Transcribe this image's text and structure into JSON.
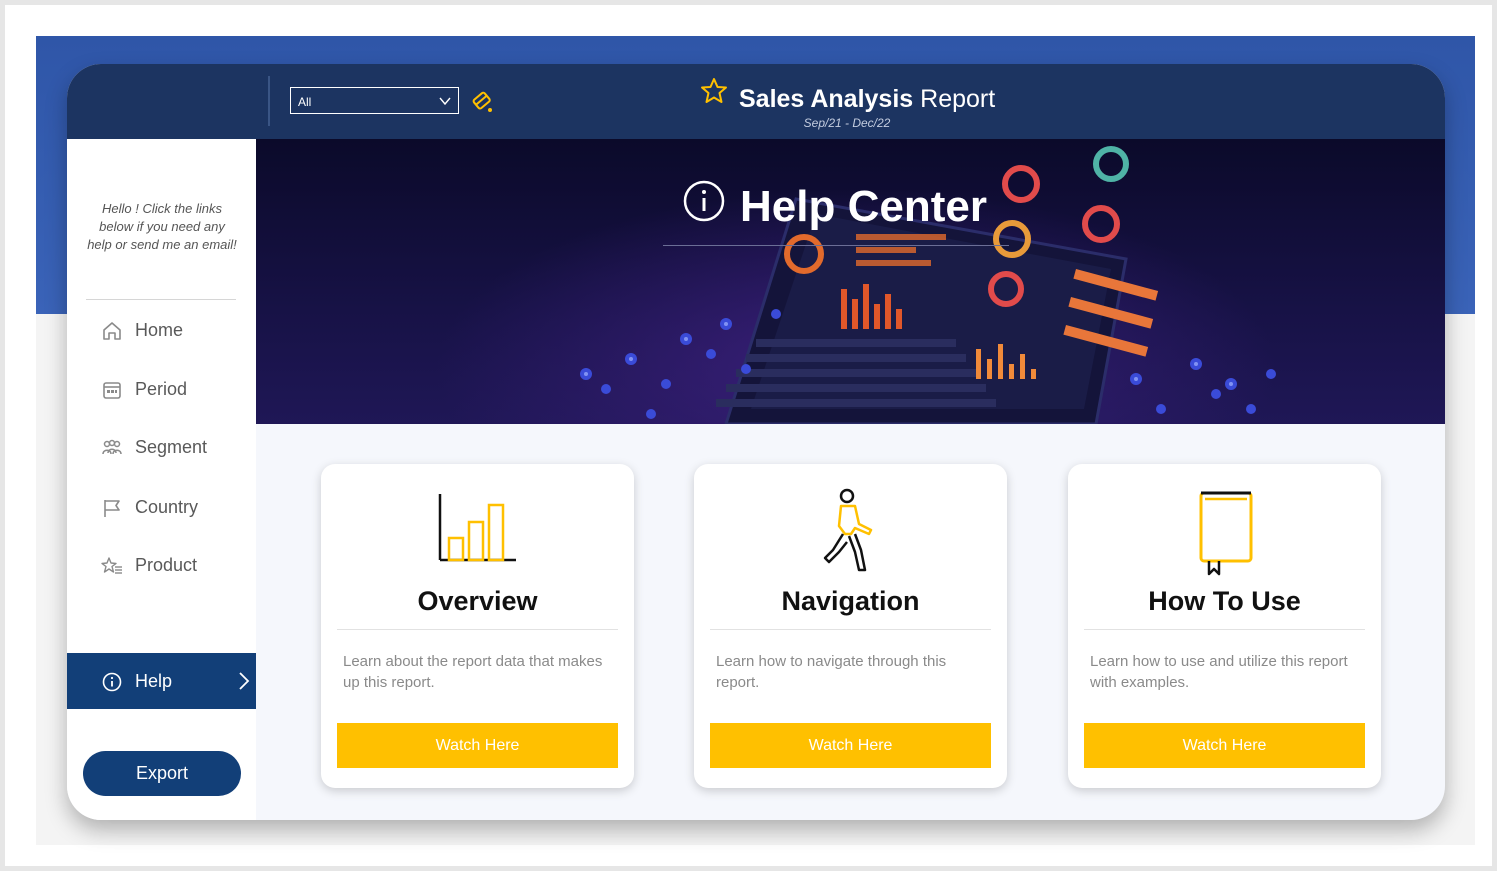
{
  "header": {
    "filter": {
      "selected": "All"
    },
    "title_bold": "Sales Analysis",
    "title_rest": " Report",
    "subtitle": "Sep/21 - Dec/22",
    "icons": {
      "filter_chevron": "chevron-down-icon",
      "clear": "eraser-icon",
      "title": "star-icon"
    }
  },
  "sidebar": {
    "message": "Hello ! Click the links below if you need any help or send me an email!",
    "items": [
      {
        "label": "Home",
        "icon": "home-icon"
      },
      {
        "label": "Period",
        "icon": "calendar-icon"
      },
      {
        "label": "Segment",
        "icon": "people-icon"
      },
      {
        "label": "Country",
        "icon": "flag-icon"
      },
      {
        "label": "Product",
        "icon": "star-list-icon"
      },
      {
        "label": "Help",
        "icon": "info-icon",
        "active": true
      }
    ],
    "export_label": "Export"
  },
  "hero": {
    "title": "Help Center",
    "icon": "info-icon"
  },
  "cards": [
    {
      "title": "Overview",
      "description": "Learn about the report data that makes up this report.",
      "button": "Watch Here",
      "icon": "bar-chart-icon"
    },
    {
      "title": "Navigation",
      "description": "Learn how to navigate through this report.",
      "button": "Watch Here",
      "icon": "walking-person-icon"
    },
    {
      "title": "How To Use",
      "description": "Learn how to use and utilize this report with examples.",
      "button": "Watch Here",
      "icon": "book-icon"
    }
  ],
  "colors": {
    "navy": "#1c3461",
    "active_nav": "#123f78",
    "accent_yellow": "#ffc000",
    "page_blue": "#2f56a8"
  }
}
